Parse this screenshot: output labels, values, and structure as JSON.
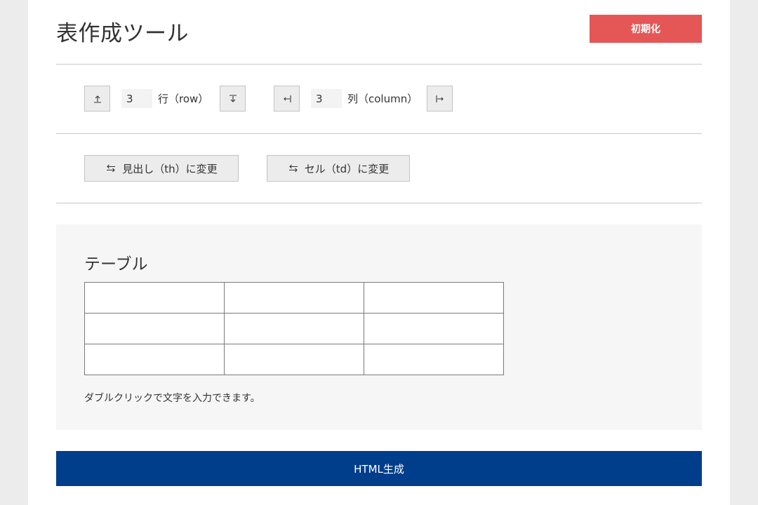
{
  "app": {
    "title": "表作成ツール"
  },
  "header": {
    "reset_label": "初期化"
  },
  "rows": {
    "value": "3",
    "label": "行（row）"
  },
  "cols": {
    "value": "3",
    "label": "列（column）"
  },
  "convert": {
    "to_th_label": "見出し（th）に変更",
    "to_td_label": "セル（td）に変更"
  },
  "panel": {
    "title": "テーブル",
    "hint": "ダブルクリックで文字を入力できます。",
    "table": [
      [
        "",
        "",
        ""
      ],
      [
        "",
        "",
        ""
      ],
      [
        "",
        "",
        ""
      ]
    ]
  },
  "footer": {
    "generate_label": "HTML生成"
  },
  "colors": {
    "reset": "#e55656",
    "generate": "#003e8c",
    "panel": "#f6f6f6",
    "background": "#ececec"
  },
  "icons": {
    "add_row_above": "arrow-up-bar-icon",
    "add_row_below": "arrow-down-bar-icon",
    "add_col_left": "arrow-left-bar-icon",
    "add_col_right": "arrow-right-bar-icon",
    "swap": "swap-arrows-icon"
  }
}
